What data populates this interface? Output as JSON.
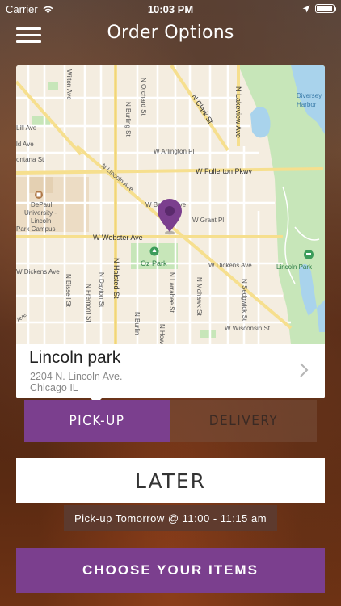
{
  "status_bar": {
    "carrier": "Carrier",
    "time": "10:03 PM"
  },
  "nav": {
    "title": "Order Options",
    "menu_icon": "hamburger-menu-icon"
  },
  "location": {
    "name": "Lincoln park",
    "address_line1": "2204 N. Lincoln Ave.",
    "address_line2": "Chicago IL",
    "chevron_icon": "chevron-right-icon"
  },
  "map": {
    "pin_icon": "map-pin-icon",
    "labels": {
      "wilton": "Wilton Ave",
      "orchard": "N Orchard St",
      "burling_top": "N Burling St",
      "clark": "N Clark St",
      "lakeview": "N Lakeview Ave",
      "diversey": "Diversey",
      "harbor": "Harbor",
      "lill": "Lill Ave",
      "ld": "ld Ave",
      "montana": "ontana St",
      "arlington": "W Arlington Pl",
      "fullerton": "W Fullerton Pkwy",
      "lincoln_ave": "N Lincoln Ave",
      "depaul1": "DePaul",
      "depaul2": "University -",
      "depaul3": "Lincoln",
      "depaul4": "Park Campus",
      "belden": "W Belden Ave",
      "grant": "W Grant Pl",
      "webster": "W Webster Ave",
      "oz_park": "Oz Park",
      "halsted": "N Halsted St",
      "dickens_left": "W Dickens Ave",
      "dickens_right": "W Dickens Ave",
      "lincoln_park": "Lincoln Park",
      "bissell": "N Bissell St",
      "fremont": "N Fremont St",
      "dayton": "N Dayton St",
      "larrabee": "N Larrabee St",
      "mohawk": "N Mohawk St",
      "sedgwick": "N Sedgwick St",
      "burling_bottom": "N Burlin",
      "howe": "N Howe",
      "wisconsin": "W Wisconsin St",
      "ave_bottom": "Ave"
    }
  },
  "order_type": {
    "pickup_label": "PICK-UP",
    "delivery_label": "DELIVERY",
    "selected": "pickup"
  },
  "timing": {
    "later_label": "LATER",
    "pickup_time": "Pick-up Tomorrow @ 11:00 - 11:15 am"
  },
  "cta": {
    "choose_label": "CHOOSE YOUR ITEMS"
  },
  "colors": {
    "accent": "#7b3f8e",
    "park_green": "#c7e6b9",
    "water": "#a9d3ec",
    "road_yellow": "#f6df8e"
  }
}
